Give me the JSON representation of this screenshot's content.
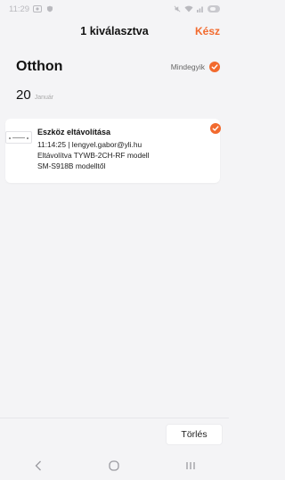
{
  "status_bar": {
    "time": "11:29",
    "left_icons": [
      "media-icon",
      "shield-icon"
    ],
    "right_icons": [
      "mute-icon",
      "wifi-icon",
      "signal-icon",
      "battery-icon"
    ]
  },
  "header": {
    "title": "1 kiválasztva",
    "done_label": "Kész"
  },
  "home": {
    "title": "Otthon",
    "select_all_label": "Mindegyik",
    "select_all_checked": true
  },
  "date_group": {
    "day": "20",
    "month": "Január"
  },
  "events": [
    {
      "title": "Eszköz eltávolítása",
      "line1": "11:14:25 | lengyel.gabor@yli.hu",
      "line2": "Eltávolítva TYWB-2CH-RF modell",
      "line3": "SM-S918B modelltől",
      "checked": true
    }
  ],
  "bottom": {
    "delete_label": "Törlés"
  },
  "colors": {
    "accent": "#f26a2e",
    "background": "#f4f4f6",
    "card": "#ffffff"
  }
}
